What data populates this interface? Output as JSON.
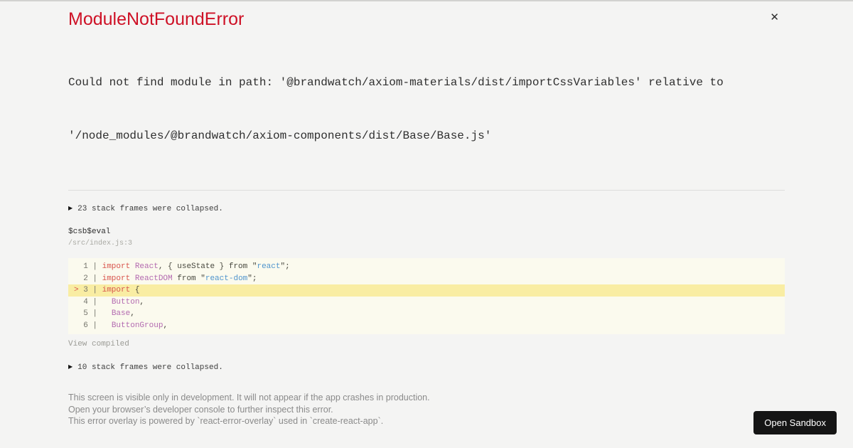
{
  "colors": {
    "accent_red": "#ce1126",
    "code_background": "#fbfaee",
    "highlight_yellow": "#f9eda3",
    "keyword_red": "#d8544c",
    "identifier_purple": "#b36ab0",
    "string_blue": "#4f94cd",
    "button_background": "#151515",
    "page_background": "#f4f4f3"
  },
  "header": {
    "title": "ModuleNotFoundError",
    "close_icon": "✕"
  },
  "error": {
    "message_line1": "Could not find module in path: '@brandwatch/axiom-materials/dist/importCssVariables' relative to",
    "message_line2": "'/node_modules/@brandwatch/axiom-components/dist/Base/Base.js'"
  },
  "stack": {
    "expand_icon": "▶",
    "top_collapsed": "23 stack frames were collapsed.",
    "bottom_collapsed": "10 stack frames were collapsed."
  },
  "frame": {
    "function_name": "$csb$eval",
    "location": "/src/index.js:3"
  },
  "code": {
    "view_compiled_label": "View compiled",
    "lines": [
      {
        "highlighted": false,
        "tokens": [
          [
            "ln",
            "  1 | "
          ],
          [
            "kw",
            "import"
          ],
          [
            "pl",
            " "
          ],
          [
            "id",
            "React"
          ],
          [
            "pl",
            ", { useState } from \""
          ],
          [
            "st",
            "react"
          ],
          [
            "pl",
            "\";"
          ]
        ]
      },
      {
        "highlighted": false,
        "tokens": [
          [
            "ln",
            "  2 | "
          ],
          [
            "kw",
            "import"
          ],
          [
            "pl",
            " "
          ],
          [
            "id",
            "ReactDOM"
          ],
          [
            "pl",
            " from \""
          ],
          [
            "st",
            "react-dom"
          ],
          [
            "pl",
            "\";"
          ]
        ]
      },
      {
        "highlighted": true,
        "tokens": [
          [
            "mk",
            "> "
          ],
          [
            "ln",
            "3 | "
          ],
          [
            "kw",
            "import"
          ],
          [
            "pl",
            " {"
          ]
        ]
      },
      {
        "highlighted": false,
        "tokens": [
          [
            "ln",
            "  4 | "
          ],
          [
            "pl",
            "  "
          ],
          [
            "id",
            "Button"
          ],
          [
            "pl",
            ","
          ]
        ]
      },
      {
        "highlighted": false,
        "tokens": [
          [
            "ln",
            "  5 | "
          ],
          [
            "pl",
            "  "
          ],
          [
            "id",
            "Base"
          ],
          [
            "pl",
            ","
          ]
        ]
      },
      {
        "highlighted": false,
        "tokens": [
          [
            "ln",
            "  6 | "
          ],
          [
            "pl",
            "  "
          ],
          [
            "id",
            "ButtonGroup"
          ],
          [
            "pl",
            ","
          ]
        ]
      }
    ]
  },
  "footer": {
    "lines": [
      "This screen is visible only in development. It will not appear if the app crashes in production.",
      "Open your browser’s developer console to further inspect this error.",
      "This error overlay is powered by `react-error-overlay` used in `create-react-app`."
    ]
  },
  "sandbox": {
    "open_button_label": "Open Sandbox"
  }
}
